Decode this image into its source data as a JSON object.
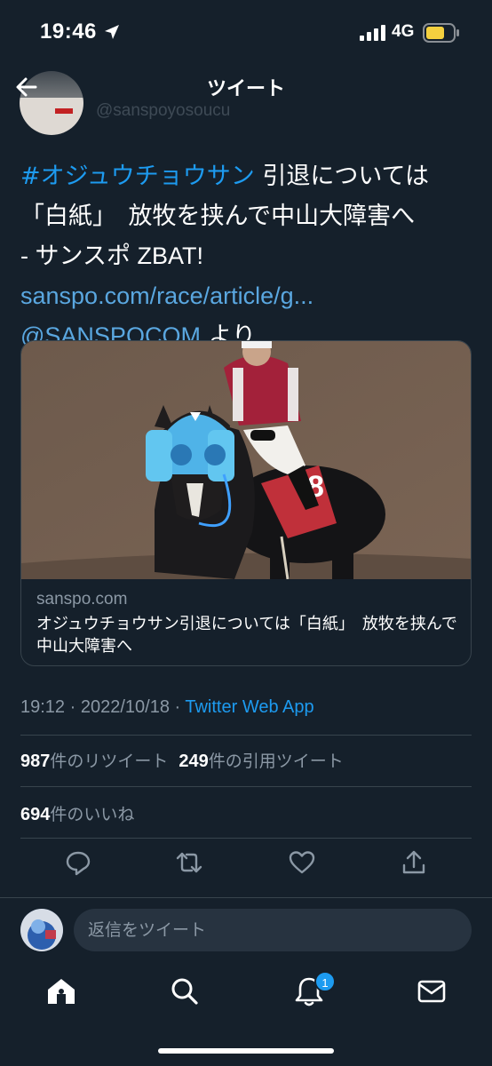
{
  "status_bar": {
    "time": "19:46",
    "network": "4G",
    "icons": [
      "location-arrow-icon",
      "cellular-signal-icon",
      "battery-icon"
    ],
    "battery_color": "#f4d03f"
  },
  "header": {
    "title": "ツイート",
    "back_icon": "arrow-left-icon"
  },
  "tweet": {
    "hashtag": "#オジュウチョウサン",
    "text_part1": " 引退については",
    "text_part2": "「白紙」　放牧を挟んで中山大障害へ",
    "text_part3": "- サンスポ ZBAT! ",
    "link": "sanspo.com/race/article/g...",
    "mention": "@SANSPOCOM",
    "text_part4": " より"
  },
  "card": {
    "domain": "sanspo.com",
    "title": "オジュウチョウサン引退については「白紙」　放牧を挟んで中山大障害へ",
    "saddle_number": "8"
  },
  "meta": {
    "time": "19:12",
    "separator": " · ",
    "date": "2022/10/18",
    "source": "Twitter Web App"
  },
  "stats": {
    "retweets_count": "987",
    "retweets_label": "件のリツイート",
    "quotes_count": "249",
    "quotes_label": "件の引用ツイート",
    "likes_count": "694",
    "likes_label": "件のいいね"
  },
  "actions": [
    "reply-icon",
    "retweet-icon",
    "like-icon",
    "share-icon"
  ],
  "reply": {
    "placeholder": "返信をツイート"
  },
  "tabs": [
    "home-icon",
    "search-icon",
    "notifications-icon",
    "messages-icon"
  ],
  "notification_badge": "1",
  "colors": {
    "background": "#15202b",
    "accent": "#1d9bf0",
    "secondary_text": "#8b98a5",
    "divider": "#38444d"
  }
}
